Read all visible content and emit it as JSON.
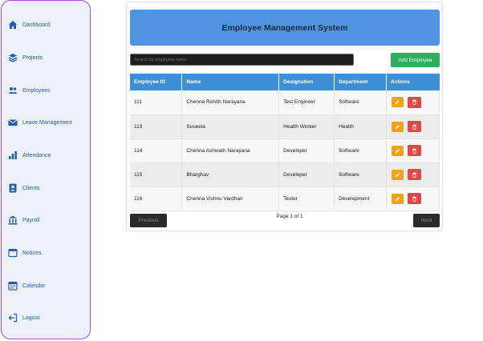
{
  "sidebar": {
    "items": [
      {
        "label": "Dashboard",
        "icon": "home-icon"
      },
      {
        "label": "Projects",
        "icon": "layers-icon"
      },
      {
        "label": "Employees",
        "icon": "users-icon"
      },
      {
        "label": "Leave Management",
        "icon": "envelope-icon"
      },
      {
        "label": "Attendance",
        "icon": "bar-chart-icon"
      },
      {
        "label": "Clients",
        "icon": "id-card-icon"
      },
      {
        "label": "Payroll",
        "icon": "bank-icon"
      },
      {
        "label": "Notices",
        "icon": "window-icon"
      },
      {
        "label": "Calendar",
        "icon": "calendar-icon"
      },
      {
        "label": "Logout",
        "icon": "logout-icon"
      }
    ]
  },
  "header": {
    "title": "Employee Management System"
  },
  "search": {
    "placeholder": "Search by employee name",
    "value": ""
  },
  "add_button": {
    "label": "Add Employee"
  },
  "table": {
    "columns": [
      "Employee ID",
      "Name",
      "Designation",
      "Department",
      "Actions"
    ],
    "rows": [
      {
        "id": "111",
        "name": "Chenna Rohith Narayana",
        "designation": "Test Engineer",
        "department": "Software"
      },
      {
        "id": "113",
        "name": "Suseela",
        "designation": "Health Worker",
        "department": "Health"
      },
      {
        "id": "114",
        "name": "Chenna Ashwath Narayana",
        "designation": "Developer",
        "department": "Software"
      },
      {
        "id": "115",
        "name": "Bharghav",
        "designation": "Developer",
        "department": "Software"
      },
      {
        "id": "116",
        "name": "Chenna Vishnu Vardhan",
        "designation": "Tester",
        "department": "Development"
      }
    ]
  },
  "pagination": {
    "prev_label": "Previous",
    "next_label": "Next",
    "info": "Page 1 of 1"
  },
  "colors": {
    "sidebar_border": "#9b4fd8",
    "sidebar_text": "#1f5fb0",
    "header_bg": "#4f94de",
    "table_header_bg": "#3f8fd6",
    "add_button": "#2fae5c",
    "edit_button": "#f0a11e",
    "delete_button": "#e04848"
  }
}
